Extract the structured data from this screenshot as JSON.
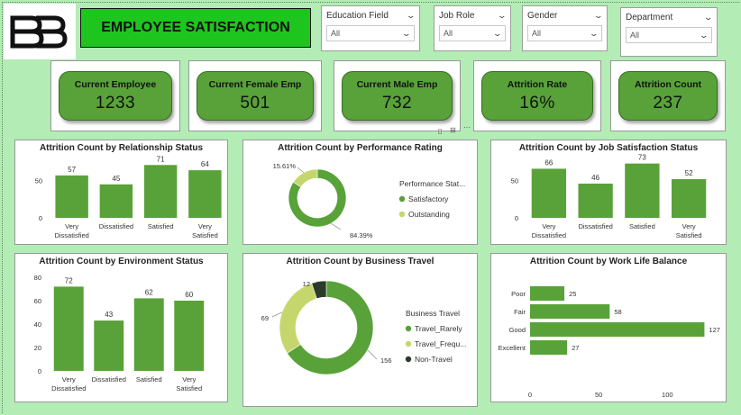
{
  "title": "EMPLOYEE SATISFACTION",
  "colors": {
    "bar": "#58a239",
    "light": "#c5d76c",
    "dark": "#2b3a2b",
    "title_bg": "#1fc51f"
  },
  "slicers": [
    {
      "label": "Education Field",
      "value": "All"
    },
    {
      "label": "Job Role",
      "value": "All"
    },
    {
      "label": "Gender",
      "value": "All"
    },
    {
      "label": "Department",
      "value": "All"
    }
  ],
  "kpis": [
    {
      "label": "Current Employee",
      "value": "1233"
    },
    {
      "label": "Current Female Emp",
      "value": "501"
    },
    {
      "label": "Current Male Emp",
      "value": "732"
    },
    {
      "label": "Attrition Rate",
      "value": "16%"
    },
    {
      "label": "Attrition Count",
      "value": "237"
    }
  ],
  "chart_data": [
    {
      "type": "bar",
      "title": "Attrition Count by Relationship Status",
      "categories": [
        "Very Dissatisfied",
        "Dissatisfied",
        "Satisfied",
        "Very Satisfied"
      ],
      "values": [
        57,
        45,
        71,
        64
      ],
      "yticks": [
        "50",
        "0"
      ],
      "ylim": [
        0,
        75
      ]
    },
    {
      "type": "pie",
      "title": "Attrition Count by Performance Rating",
      "legend_title": "Performance Stat...",
      "labels": [
        "Satisfactory",
        "Outstanding"
      ],
      "values": [
        84.39,
        15.61
      ],
      "value_labels": [
        "84.39%",
        "15.61%"
      ]
    },
    {
      "type": "bar",
      "title": "Attrition Count by Job Satisfaction Status",
      "categories": [
        "Very Dissatisfied",
        "Dissatisfied",
        "Satisfied",
        "Very Satisfied"
      ],
      "values": [
        66,
        46,
        73,
        52
      ],
      "yticks": [
        "50",
        "0"
      ],
      "ylim": [
        0,
        75
      ]
    },
    {
      "type": "bar",
      "title": "Attrition Count by Environment Status",
      "categories": [
        "Very Dissatisfied",
        "Dissatisfied",
        "Satisfied",
        "Very Satisfied"
      ],
      "values": [
        72,
        43,
        62,
        60
      ],
      "yticks": [
        "80",
        "60",
        "40",
        "20",
        "0"
      ],
      "ylim": [
        0,
        80
      ]
    },
    {
      "type": "pie",
      "title": "Attrition Count by Business Travel",
      "legend_title": "Business Travel",
      "labels": [
        "Travel_Rarely",
        "Travel_Frequ...",
        "Non-Travel"
      ],
      "values": [
        156,
        69,
        12
      ],
      "value_labels": [
        "156",
        "69",
        "12"
      ]
    },
    {
      "type": "bar",
      "orientation": "horizontal",
      "title": "Attrition Count by Work Life Balance",
      "categories": [
        "Poor",
        "Fair",
        "Good",
        "Excellent"
      ],
      "values": [
        25,
        58,
        127,
        27
      ],
      "xticks": [
        "0",
        "50",
        "100"
      ],
      "xlim": [
        0,
        130
      ]
    }
  ]
}
